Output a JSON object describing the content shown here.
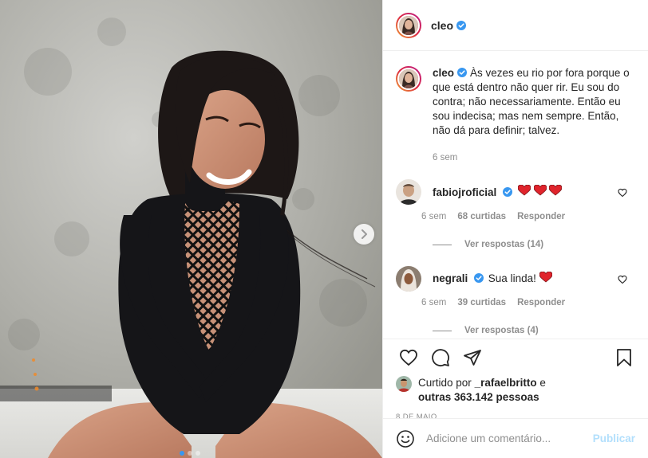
{
  "post": {
    "author": "cleo",
    "photo_alt": "",
    "carousel_dots": 3,
    "carousel_active": 0
  },
  "caption": {
    "username": "cleo",
    "text": "Às vezes eu rio por fora porque o que está dentro não quer rir. Eu sou do contra; não necessariamente. Então eu sou indecisa; mas nem sempre. Então, não dá para definir; talvez.",
    "time": "6 sem"
  },
  "comments": [
    {
      "username": "fabiojroficial",
      "text": "",
      "hearts": 3,
      "time": "6 sem",
      "likes": "68 curtidas",
      "reply_label": "Responder",
      "view_replies": "Ver respostas (14)"
    },
    {
      "username": "negrali",
      "text": "Sua linda!",
      "hearts": 1,
      "time": "6 sem",
      "likes": "39 curtidas",
      "reply_label": "Responder",
      "view_replies": "Ver respostas (4)"
    }
  ],
  "likes": {
    "prefix": "Curtido por",
    "user": "_rafaelbritto",
    "conj": "e",
    "others": "outras 363.142 pessoas"
  },
  "date": "8 DE MAIO",
  "add_comment": {
    "placeholder": "Adicione um comentário...",
    "publish_label": "Publicar"
  },
  "colors": {
    "verified": "#3897f0",
    "heart": "#ed4956",
    "publish_disabled": "#b2dffc"
  }
}
